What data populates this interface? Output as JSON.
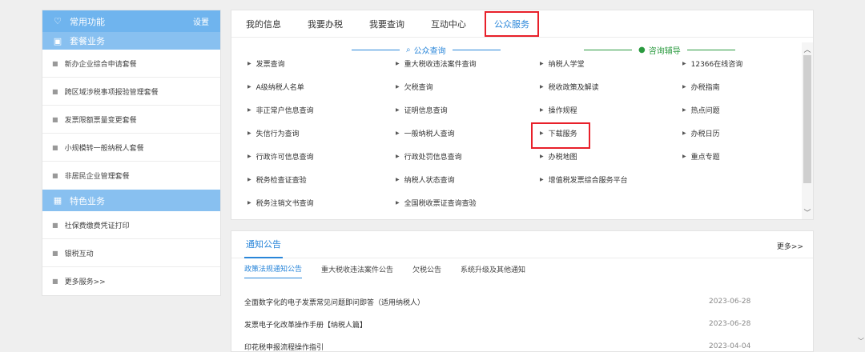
{
  "sidebar": {
    "common": {
      "title": "常用功能",
      "action": "设置"
    },
    "package": {
      "title": "套餐业务"
    },
    "package_items": [
      "新办企业综合申请套餐",
      "跨区域涉税事项报验管理套餐",
      "发票限额票量变更套餐",
      "小规模转一般纳税人套餐",
      "非居民企业管理套餐"
    ],
    "special": {
      "title": "特色业务"
    },
    "special_items": [
      "社保费缴费凭证打印",
      "银税互动",
      "更多服务>>"
    ]
  },
  "tabs": [
    "我的信息",
    "我要办税",
    "我要查询",
    "互动中心",
    "公众服务"
  ],
  "sections": {
    "query": "公众查询",
    "help": "咨询辅导"
  },
  "grid": [
    [
      "发票查询",
      "重大税收违法案件查询",
      "纳税人学堂",
      "12366在线咨询"
    ],
    [
      "A级纳税人名单",
      "欠税查询",
      "税收政策及解读",
      "办税指南"
    ],
    [
      "非正常户信息查询",
      "证明信息查询",
      "操作规程",
      "热点问题"
    ],
    [
      "失信行为查询",
      "一般纳税人查询",
      "下载服务",
      "办税日历"
    ],
    [
      "行政许可信息查询",
      "行政处罚信息查询",
      "办税地图",
      "重点专题"
    ],
    [
      "税务检查证查验",
      "纳税人状态查询",
      "增值税发票综合服务平台",
      ""
    ],
    [
      "税务注销文书查询",
      "全国税收票证查询查验",
      "",
      ""
    ]
  ],
  "notice": {
    "title": "通知公告",
    "more": "更多>>",
    "subtabs": [
      "政策法规通知公告",
      "重大税收违法案件公告",
      "欠税公告",
      "系统升级及其他通知"
    ],
    "rows": [
      {
        "title": "全面数字化的电子发票常见问题即问即答（适用纳税人）",
        "date": "2023-06-28"
      },
      {
        "title": "发票电子化改革操作手册【纳税人篇】",
        "date": "2023-06-28"
      },
      {
        "title": "印花税申报流程操作指引",
        "date": "2023-04-04"
      }
    ]
  },
  "colors": {
    "accent": "#2a86d9",
    "highlight": "#e8202a",
    "green": "#2a9a3f",
    "sidebar_head": "#6fb4ee"
  },
  "icons": [
    "heart-icon",
    "briefcase-icon",
    "grid-icon",
    "search-doc-icon",
    "chat-icon",
    "triangle-right-icon"
  ]
}
